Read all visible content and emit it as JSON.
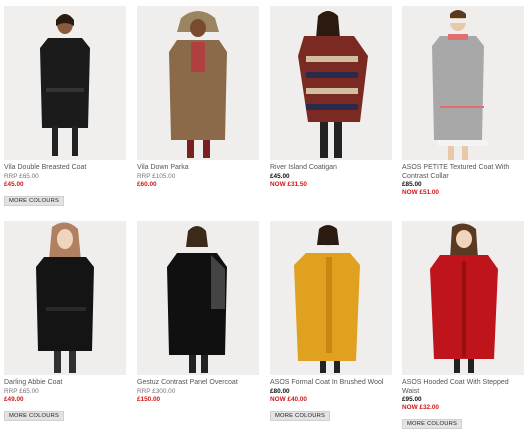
{
  "colors": {
    "price_red": "#d01818",
    "badge_pink": "#e0507a",
    "button_bg": "#e3e3e3"
  },
  "products": [
    {
      "name": "Vila Double Breasted Coat",
      "rrp": "RRP £65.00",
      "price": "£45.00",
      "more": "MORE COLOURS"
    },
    {
      "name": "Vila Down Parka",
      "rrp": "RRP £105.00",
      "price": "£60.00"
    },
    {
      "name": "River Island Coatigan",
      "price": "£45.00",
      "now": "NOW £31.50"
    },
    {
      "name": "ASOS PETITE Textured Coat With Contrast Collar",
      "badge": "petite",
      "price": "£85.00",
      "now": "NOW £51.00"
    },
    {
      "name": "Darling Abbie Coat",
      "rrp": "RRP £65.00",
      "price": "£49.00",
      "more": "MORE COLOURS"
    },
    {
      "name": "Gestuz Contrast Panel Overcoat",
      "rrp": "RRP £300.00",
      "price": "£150.00"
    },
    {
      "name": "ASOS Formal Coat In Brushed Wool",
      "price": "£80.00",
      "now": "NOW £40.00",
      "more": "MORE COLOURS"
    },
    {
      "name": "ASOS Hooded Coat With Stepped Waist",
      "price": "£95.00",
      "now": "NOW £32.00",
      "more": "MORE COLOURS"
    }
  ]
}
